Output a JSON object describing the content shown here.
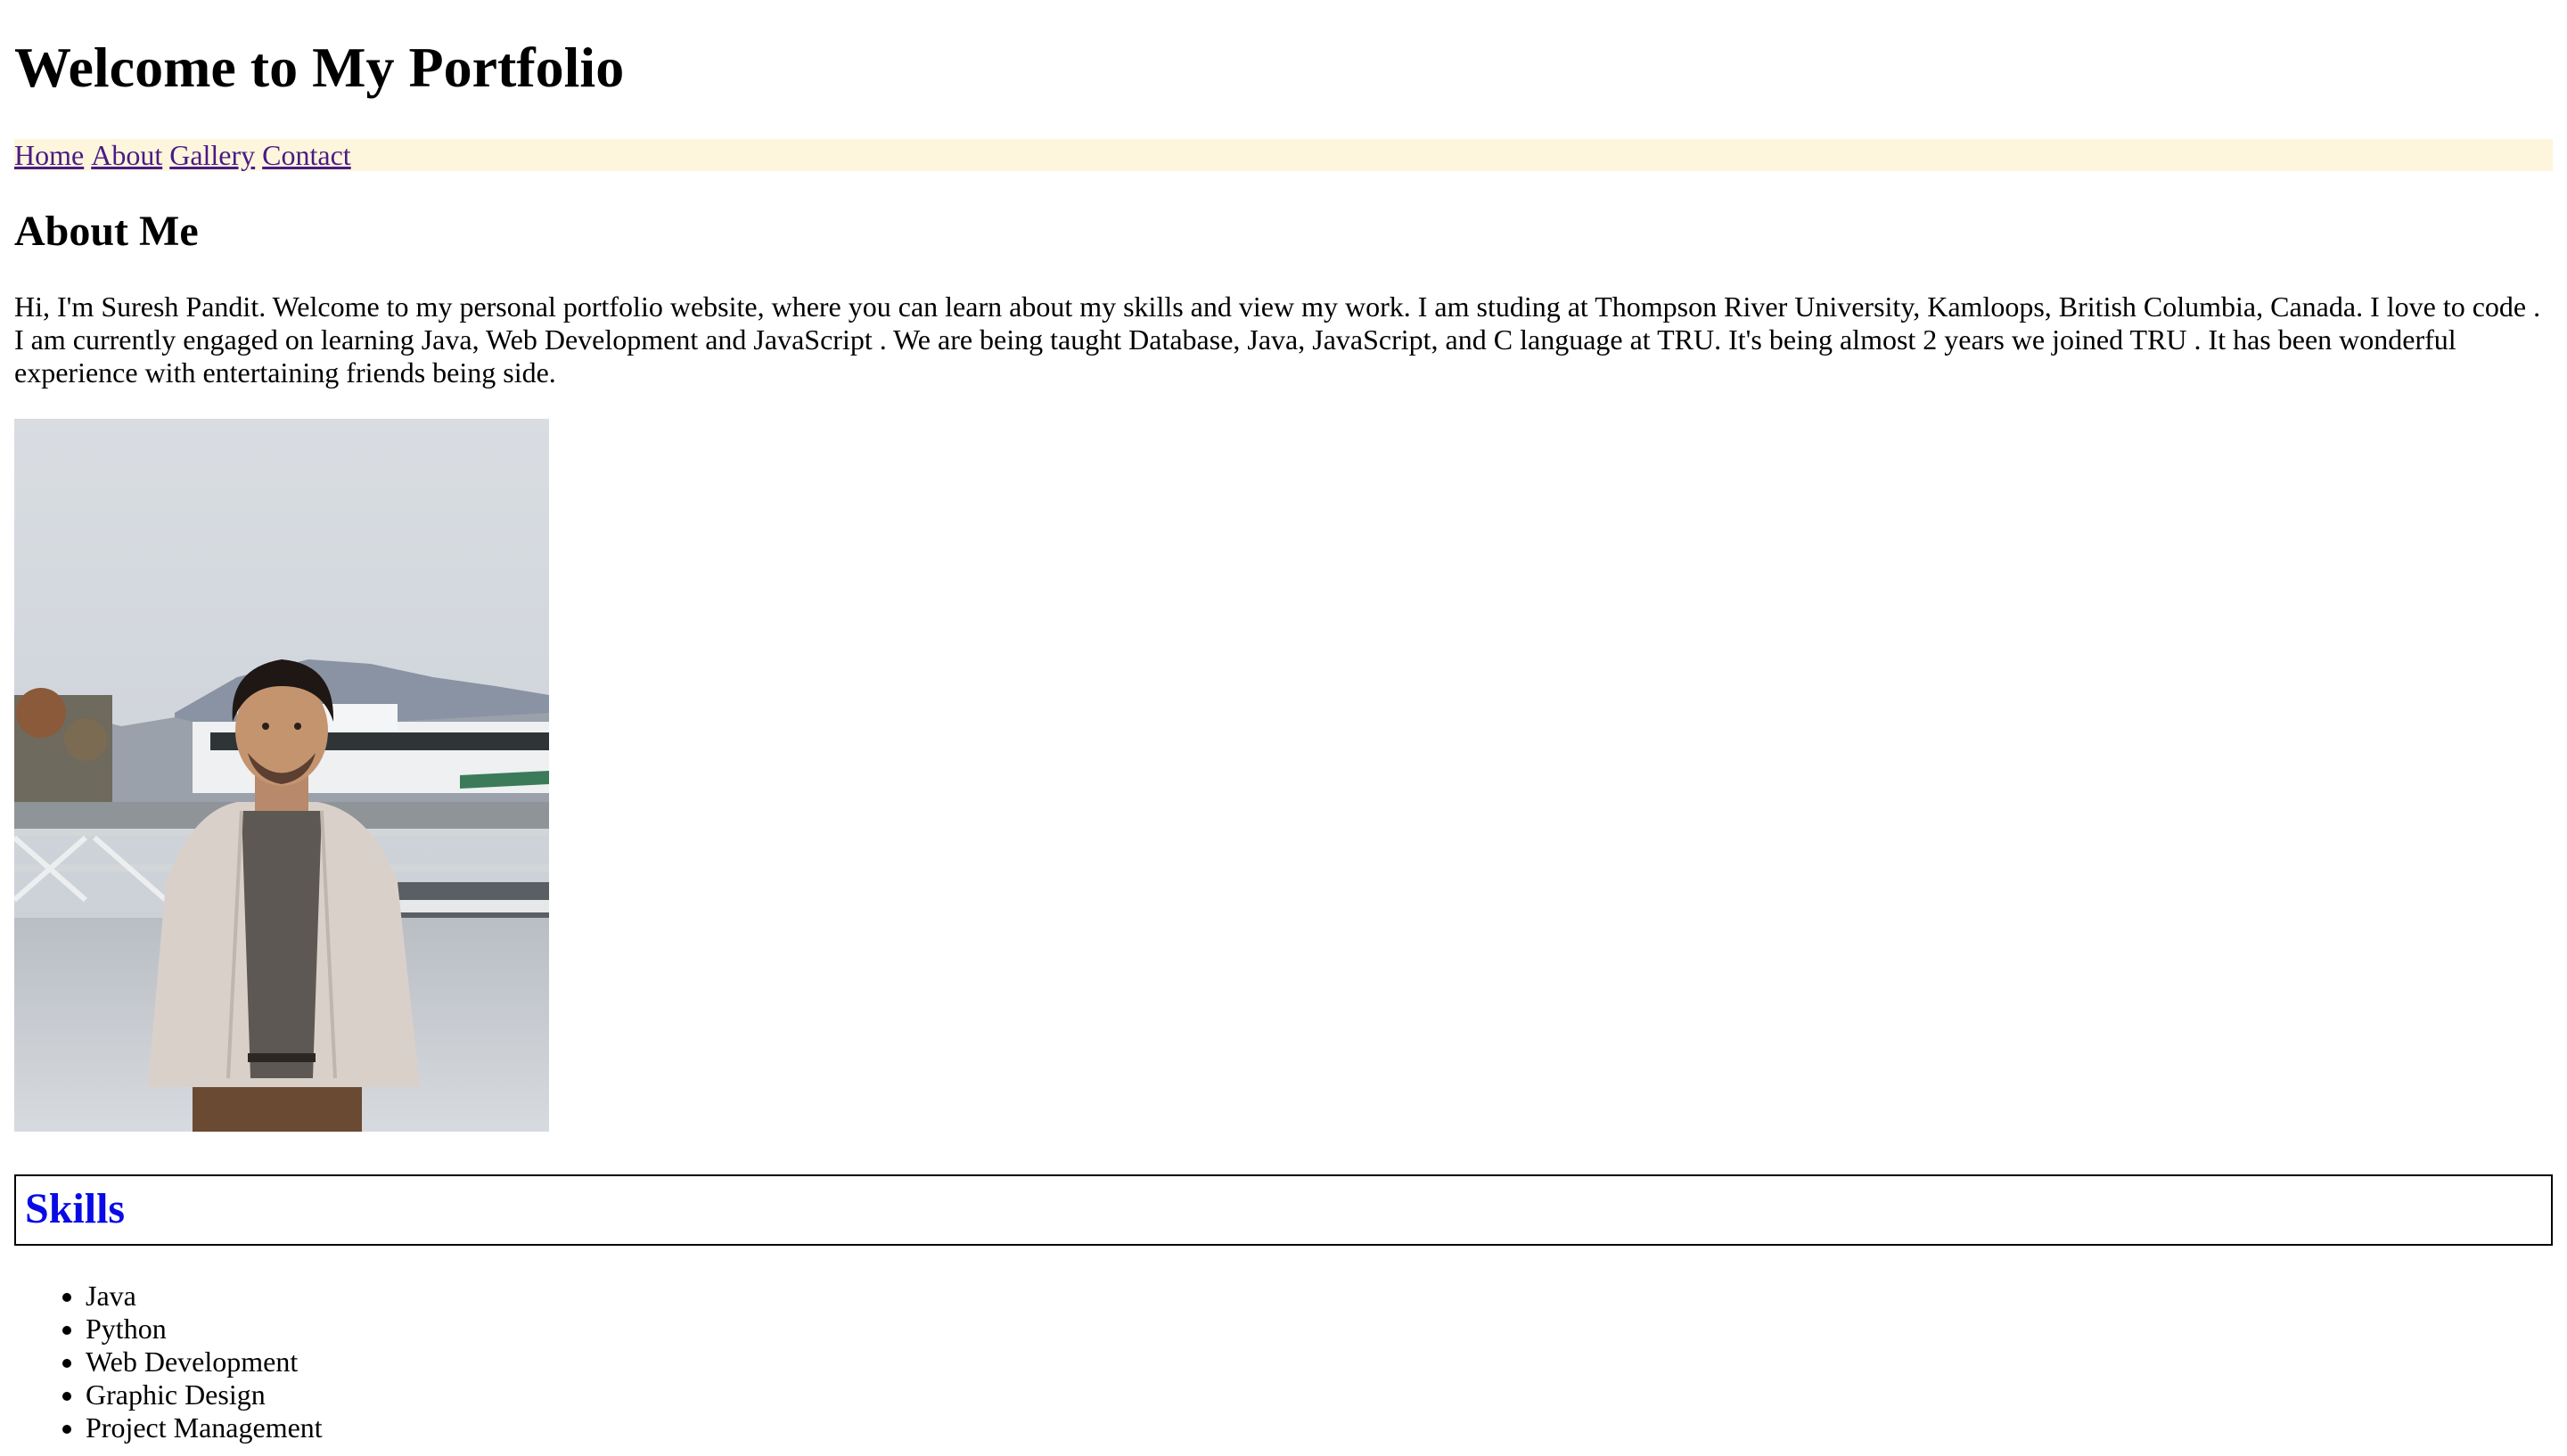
{
  "header": {
    "title": "Welcome to My Portfolio"
  },
  "nav": {
    "links": [
      {
        "label": "Home"
      },
      {
        "label": "About"
      },
      {
        "label": "Gallery"
      },
      {
        "label": "Contact"
      }
    ]
  },
  "about": {
    "heading": "About Me",
    "bio": "Hi, I'm Suresh Pandit. Welcome to my personal portfolio website, where you can learn about my skills and view my work. I am studing at Thompson River University, Kamloops, British Columbia, Canada. I love to code . I am currently engaged on learning Java, Web Development and JavaScript . We are being taught Database, Java, JavaScript, and C language at TRU. It's being almost 2 years we joined TRU . It has been wonderful experience with entertaining friends being side."
  },
  "skills": {
    "heading": "Skills",
    "items": [
      "Java",
      "Python",
      "Web Development",
      "Graphic Design",
      "Project Management"
    ]
  },
  "colors": {
    "nav_background": "#fdf6dc",
    "link": "#4b1a86",
    "skills_heading": "#0a0ae6"
  }
}
